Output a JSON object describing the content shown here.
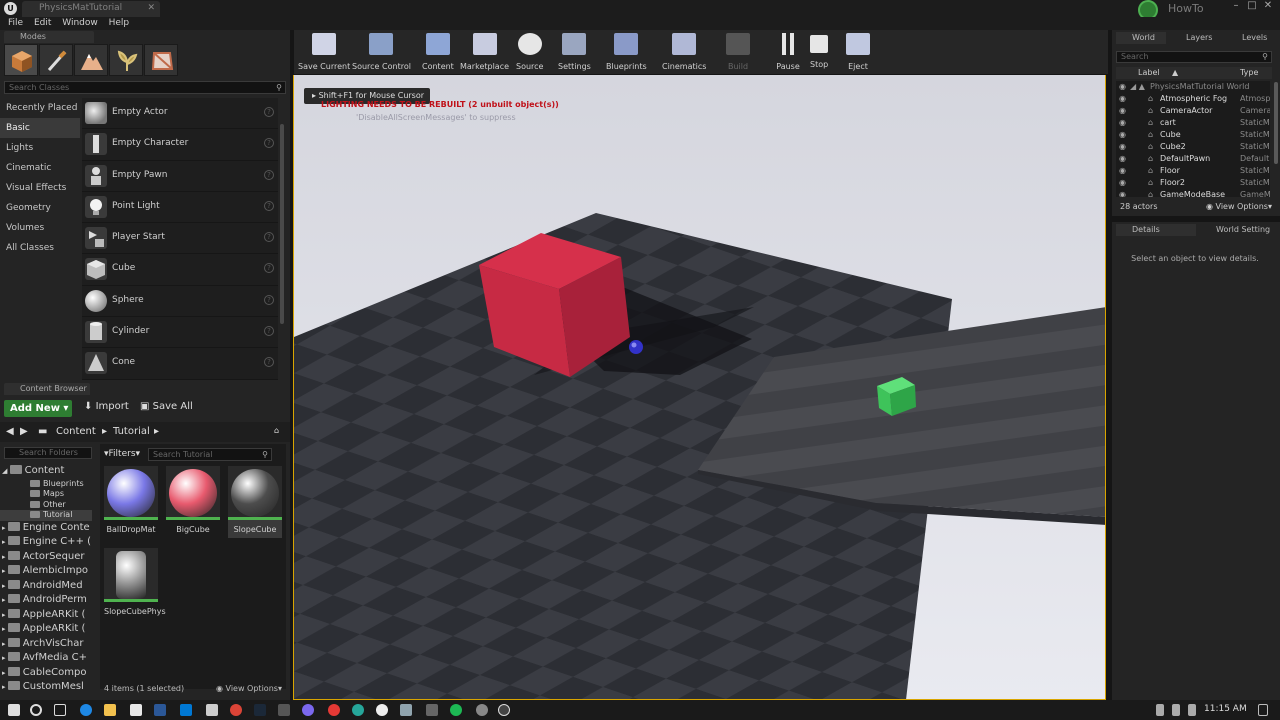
{
  "window": {
    "app_logo": "U",
    "document_tab": "PhysicsMatTutorial",
    "project_name": "HowTo",
    "controls": [
      "–",
      "□",
      "✕"
    ]
  },
  "menu": [
    "File",
    "Edit",
    "Window",
    "Help"
  ],
  "modes": {
    "tab_label": "Modes",
    "mode_icons": [
      "place-icon",
      "paint-icon",
      "landscape-icon",
      "foliage-icon",
      "geometry-edit-icon"
    ],
    "search_placeholder": "Search Classes",
    "categories": [
      "Recently Placed",
      "Basic",
      "Lights",
      "Cinematic",
      "Visual Effects",
      "Geometry",
      "Volumes",
      "All Classes"
    ],
    "active_category": "Basic",
    "items": [
      "Empty Actor",
      "Empty Character",
      "Empty Pawn",
      "Point Light",
      "Player Start",
      "Cube",
      "Sphere",
      "Cylinder",
      "Cone"
    ]
  },
  "content_browser": {
    "tab_label": "Content Browser",
    "add_new": "Add New",
    "import": "Import",
    "save_all": "Save All",
    "path": [
      "Content",
      "Tutorial"
    ],
    "folder_search_placeholder": "Search Folders",
    "tree": [
      {
        "label": "Content",
        "level": 0
      },
      {
        "label": "Blueprints",
        "level": 1
      },
      {
        "label": "Maps",
        "level": 1
      },
      {
        "label": "Other",
        "level": 1
      },
      {
        "label": "Tutorial",
        "level": 1,
        "selected": true
      },
      {
        "label": "Engine Conte",
        "level": 0
      },
      {
        "label": "Engine C++ (",
        "level": 0
      },
      {
        "label": "ActorSequer",
        "level": 0
      },
      {
        "label": "AlembicImpo",
        "level": 0
      },
      {
        "label": "AndroidMed",
        "level": 0
      },
      {
        "label": "AndroidPerm",
        "level": 0
      },
      {
        "label": "AppleARKit (",
        "level": 0
      },
      {
        "label": "AppleARKit (",
        "level": 0
      },
      {
        "label": "ArchVisChar",
        "level": 0
      },
      {
        "label": "AvfMedia C+",
        "level": 0
      },
      {
        "label": "CableCompo",
        "level": 0
      },
      {
        "label": "CustomMesl",
        "level": 0
      }
    ],
    "filters_label": "Filters",
    "asset_search_placeholder": "Search Tutorial",
    "assets": [
      {
        "name": "BallDropMat",
        "color": "#7a78e6"
      },
      {
        "name": "BigCube",
        "color": "#e85a6e"
      },
      {
        "name": "SlopeCube",
        "color": "#4d4d4d",
        "selected": true
      },
      {
        "name": "SlopeCubePhys",
        "color": "#9a9a9a"
      }
    ],
    "status": "4 items (1 selected)",
    "view_options": "View Options"
  },
  "toolbar": [
    {
      "label": "Save Current",
      "icon": "save-icon"
    },
    {
      "label": "Source Control",
      "icon": "source-control-icon"
    },
    {
      "label": "Content",
      "icon": "content-icon"
    },
    {
      "label": "Marketplace",
      "icon": "marketplace-icon"
    },
    {
      "label": "Source",
      "icon": "source-icon"
    },
    {
      "label": "Settings",
      "icon": "settings-icon"
    },
    {
      "label": "Blueprints",
      "icon": "blueprints-icon"
    },
    {
      "label": "Cinematics",
      "icon": "cinematics-icon"
    },
    {
      "label": "Build",
      "icon": "build-icon",
      "disabled": true
    },
    {
      "label": "Pause",
      "icon": "pause-icon"
    },
    {
      "label": "Stop",
      "icon": "stop-icon"
    },
    {
      "label": "Eject",
      "icon": "eject-icon"
    }
  ],
  "viewport": {
    "mouse_cursor_hint": "Shift+F1 for Mouse Cursor",
    "warning": "LIGHTING NEEDS TO BE REBUILT (2 unbuilt object(s))",
    "suppress_hint": "'DisableAllScreenMessages' to suppress"
  },
  "outliner": {
    "tabs": [
      "World",
      "Layers",
      "Levels"
    ],
    "search_placeholder": "Search",
    "col_label": "Label",
    "col_type": "Type",
    "rows": [
      {
        "label": "PhysicsMatTutorial World",
        "type": "",
        "world": true
      },
      {
        "label": "Atmospheric Fog",
        "type": "Atmospher"
      },
      {
        "label": "CameraActor",
        "type": "CameraAct"
      },
      {
        "label": "cart",
        "type": "StaticMesh"
      },
      {
        "label": "Cube",
        "type": "StaticMesh"
      },
      {
        "label": "Cube2",
        "type": "StaticMesh"
      },
      {
        "label": "DefaultPawn",
        "type": "DefaultPav"
      },
      {
        "label": "Floor",
        "type": "StaticMesh"
      },
      {
        "label": "Floor2",
        "type": "StaticMesh"
      },
      {
        "label": "GameModeBase",
        "type": "GameMode"
      }
    ],
    "count": "28 actors",
    "view_options": "View Options"
  },
  "details": {
    "tabs": [
      "Details",
      "World Setting"
    ],
    "empty_message": "Select an object to view details."
  },
  "taskbar": {
    "time": "11:15 AM"
  }
}
